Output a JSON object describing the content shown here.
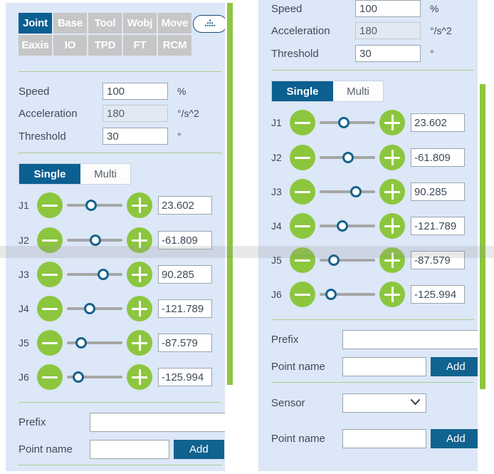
{
  "theme": {
    "panel_bg": "#dce7f7",
    "accent_blue": "#0b5f91",
    "accent_green": "#8cc63e",
    "scrollbar_green": "#8dc63f",
    "tab_inactive": "#c6c6c6",
    "divider_green": "#a9cf8e",
    "text": "#3f4b58"
  },
  "left_panel": {
    "tabs": [
      {
        "label": "Joint",
        "active": true
      },
      {
        "label": "Base",
        "active": false
      },
      {
        "label": "Tool",
        "active": false
      },
      {
        "label": "Wobj",
        "active": false
      },
      {
        "label": "Move",
        "active": false
      },
      {
        "label": "Eaxis",
        "active": false
      },
      {
        "label": "IO",
        "active": false
      },
      {
        "label": "TPD",
        "active": false
      },
      {
        "label": "FT",
        "active": false
      },
      {
        "label": "RCM",
        "active": false
      }
    ],
    "keypad_icon": "keypad-dots-icon",
    "params": [
      {
        "label": "Speed",
        "value": "100",
        "unit": "%",
        "disabled": false
      },
      {
        "label": "Acceleration",
        "value": "180",
        "unit": "°/s^2",
        "disabled": true
      },
      {
        "label": "Threshold",
        "value": "30",
        "unit": "°",
        "disabled": false
      }
    ],
    "mode_tabs": [
      {
        "label": "Single",
        "active": true
      },
      {
        "label": "Multi",
        "active": false
      }
    ],
    "joints": [
      {
        "label": "J1",
        "value": "23.602",
        "knob_pct": 43
      },
      {
        "label": "J2",
        "value": "-61.809",
        "knob_pct": 51
      },
      {
        "label": "J3",
        "value": "90.285",
        "knob_pct": 66
      },
      {
        "label": "J4",
        "value": "-121.789",
        "knob_pct": 41
      },
      {
        "label": "J5",
        "value": "-87.579",
        "knob_pct": 26
      },
      {
        "label": "J6",
        "value": "-125.994",
        "knob_pct": 21
      }
    ],
    "bottom": {
      "prefix_label": "Prefix",
      "prefix_value": "",
      "point_name_label": "Point name",
      "point_name_value": "",
      "add_label": "Add"
    }
  },
  "right_panel": {
    "params": [
      {
        "label": "Speed",
        "value": "100",
        "unit": "%",
        "disabled": false
      },
      {
        "label": "Acceleration",
        "value": "180",
        "unit": "°/s^2",
        "disabled": true
      },
      {
        "label": "Threshold",
        "value": "30",
        "unit": "°",
        "disabled": false
      }
    ],
    "mode_tabs": [
      {
        "label": "Single",
        "active": true
      },
      {
        "label": "Multi",
        "active": false
      }
    ],
    "joints": [
      {
        "label": "J1",
        "value": "23.602",
        "knob_pct": 43
      },
      {
        "label": "J2",
        "value": "-61.809",
        "knob_pct": 51
      },
      {
        "label": "J3",
        "value": "90.285",
        "knob_pct": 66
      },
      {
        "label": "J4",
        "value": "-121.789",
        "knob_pct": 41
      },
      {
        "label": "J5",
        "value": "-87.579",
        "knob_pct": 26
      },
      {
        "label": "J6",
        "value": "-125.994",
        "knob_pct": 21
      }
    ],
    "bottom": {
      "prefix_label": "Prefix",
      "prefix_value": "",
      "point_name_label": "Point name",
      "point_name_value": "",
      "add_label": "Add",
      "sensor_label": "Sensor",
      "sensor_value": "",
      "sensor_options": [
        ""
      ],
      "point_name_label_2": "Point name",
      "point_name_value_2": "",
      "add_label_2": "Add"
    }
  }
}
